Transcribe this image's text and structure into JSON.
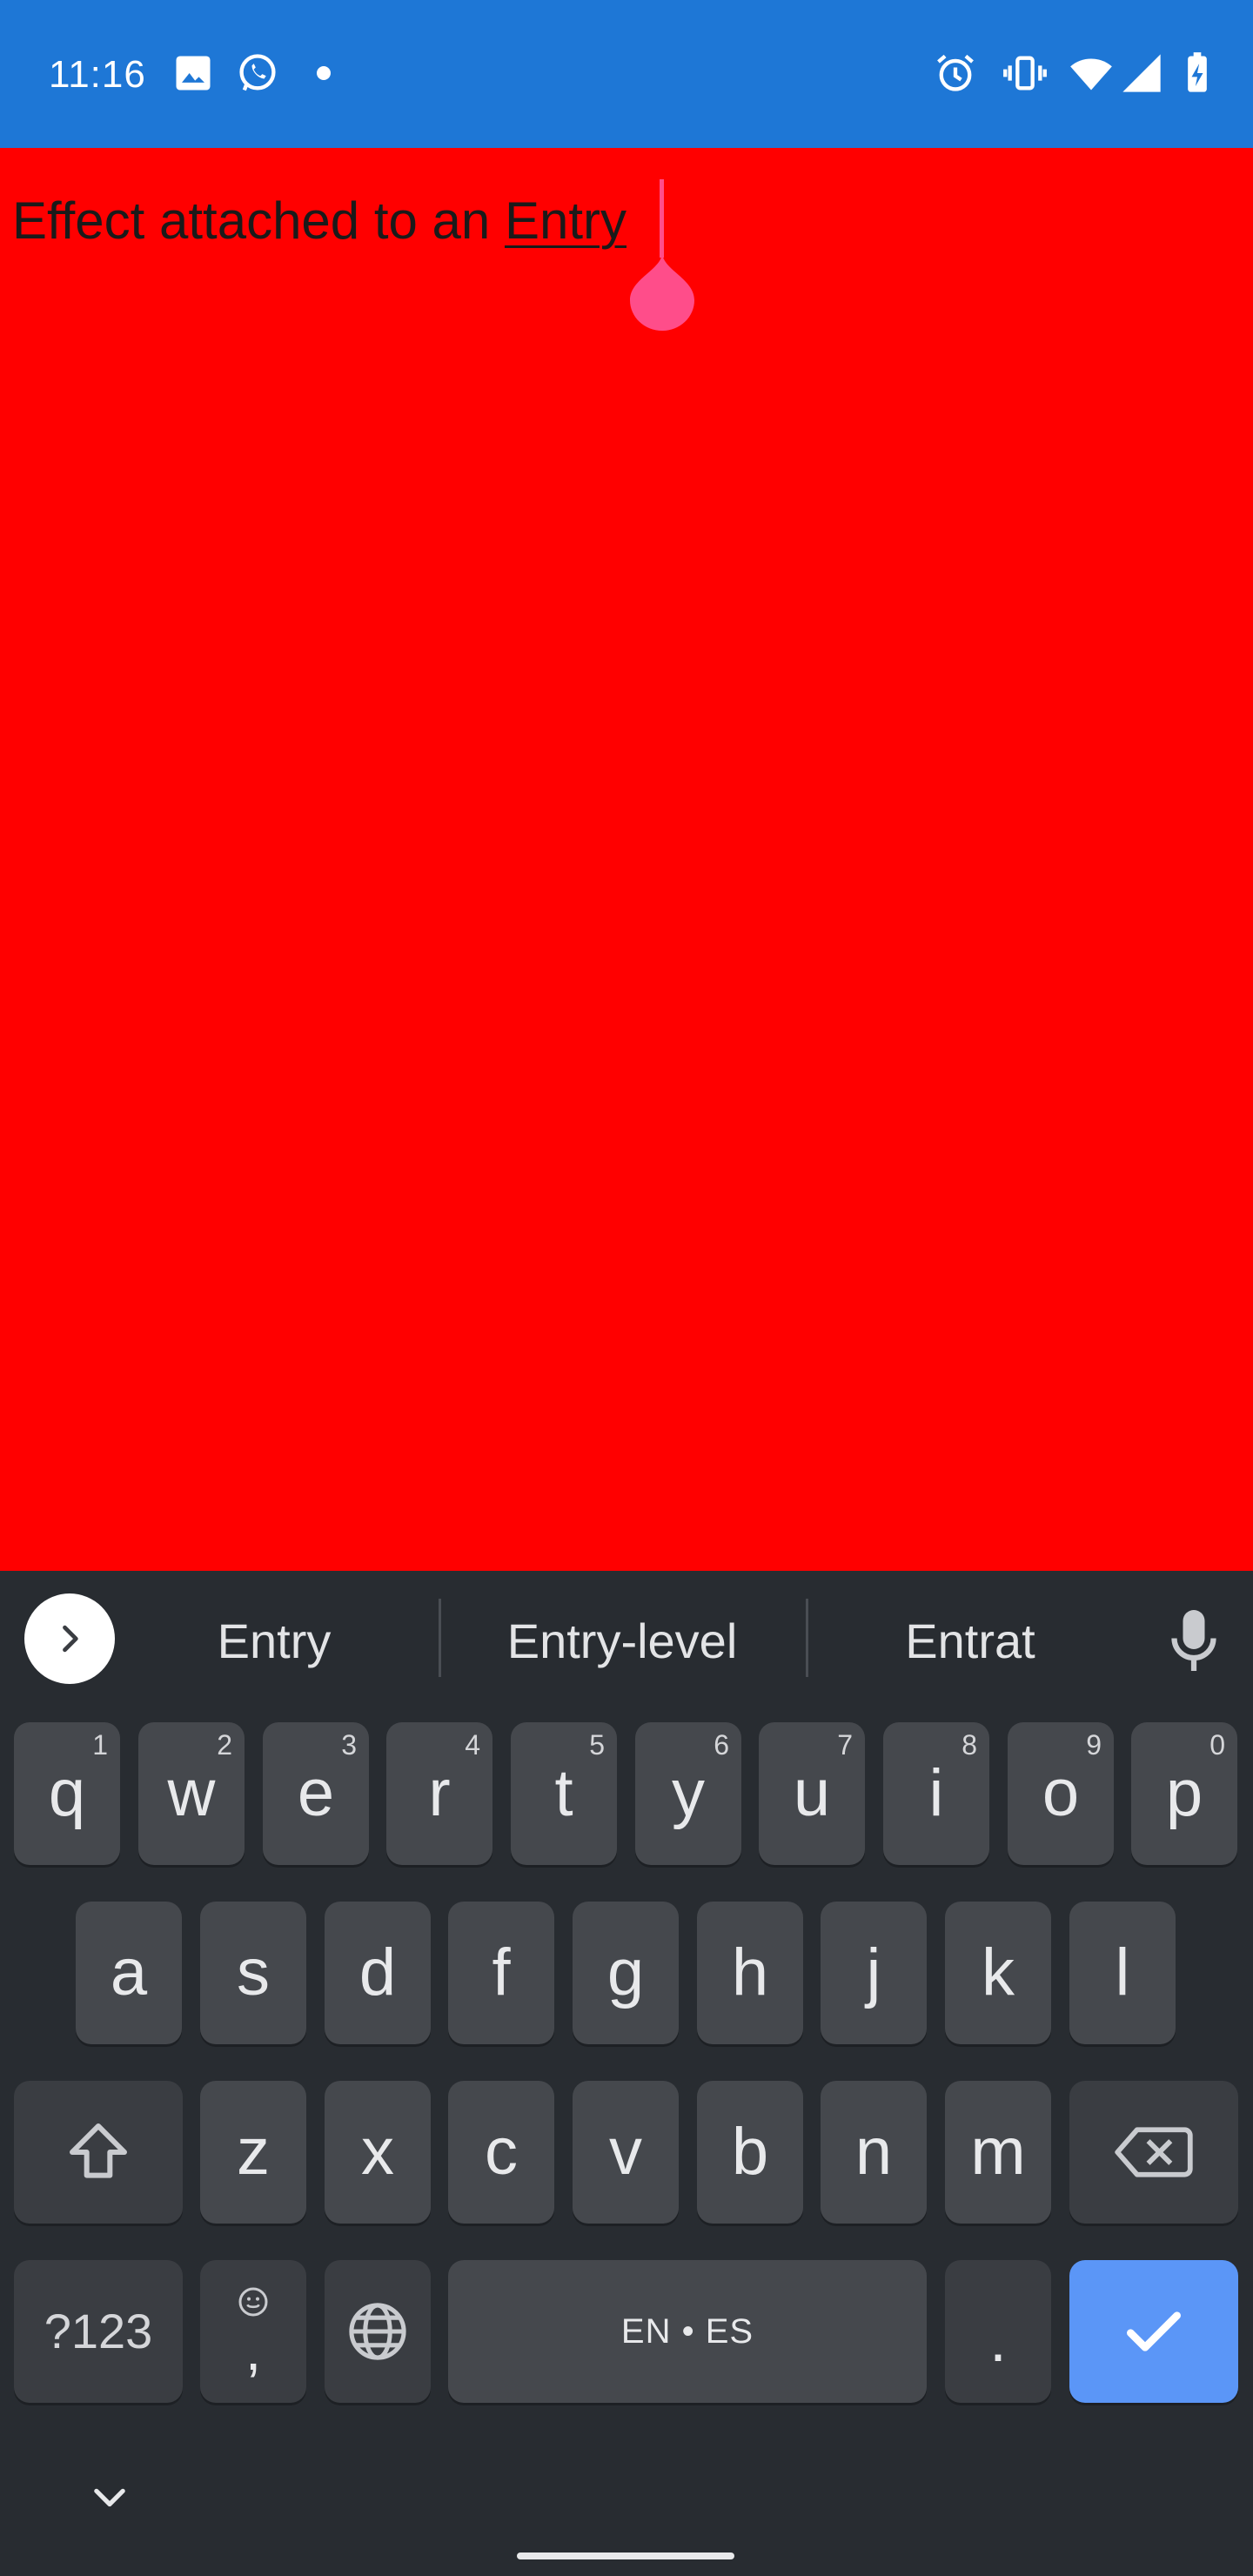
{
  "status_bar": {
    "time": "11:16",
    "background": "#1e77d6",
    "left_icons": [
      "image-icon",
      "whatsapp-icon",
      "dot-icon"
    ],
    "right_icons": [
      "alarm-icon",
      "vibrate-icon",
      "wifi-icon",
      "signal-icon",
      "battery-charging-icon"
    ]
  },
  "entry": {
    "text_prefix": "Effect attached to an ",
    "text_word": "Entry",
    "background": "#ff0000",
    "cursor_color": "#ff4d8a"
  },
  "keyboard": {
    "suggestions": [
      "Entry",
      "Entry-level",
      "Entrat"
    ],
    "row1": [
      {
        "key": "q",
        "hint": "1"
      },
      {
        "key": "w",
        "hint": "2"
      },
      {
        "key": "e",
        "hint": "3"
      },
      {
        "key": "r",
        "hint": "4"
      },
      {
        "key": "t",
        "hint": "5"
      },
      {
        "key": "y",
        "hint": "6"
      },
      {
        "key": "u",
        "hint": "7"
      },
      {
        "key": "i",
        "hint": "8"
      },
      {
        "key": "o",
        "hint": "9"
      },
      {
        "key": "p",
        "hint": "0"
      }
    ],
    "row2": [
      "a",
      "s",
      "d",
      "f",
      "g",
      "h",
      "j",
      "k",
      "l"
    ],
    "row3": [
      "z",
      "x",
      "c",
      "v",
      "b",
      "n",
      "m"
    ],
    "symbols_label": "?123",
    "comma_label": ",",
    "space_label": "EN • ES",
    "period_label": ".",
    "enter_color": "#5b96f7"
  }
}
